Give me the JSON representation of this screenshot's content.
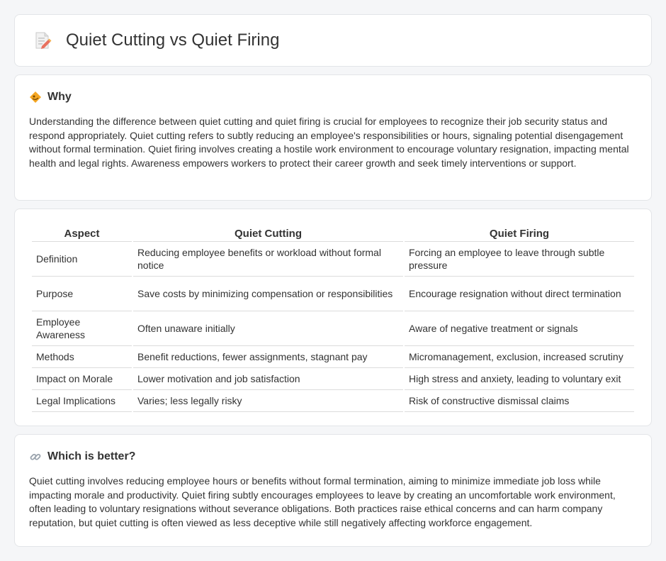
{
  "header": {
    "title": "Quiet Cutting vs Quiet Firing",
    "icon": "document-pencil-icon"
  },
  "why": {
    "title": "Why",
    "icon": "diamond-sign-icon",
    "text": "Understanding the difference between quiet cutting and quiet firing is crucial for employees to recognize their job security status and respond appropriately. Quiet cutting refers to subtly reducing an employee's responsibilities or hours, signaling potential disengagement without formal termination. Quiet firing involves creating a hostile work environment to encourage voluntary resignation, impacting mental health and legal rights. Awareness empowers workers to protect their career growth and seek timely interventions or support."
  },
  "table": {
    "headers": [
      "Aspect",
      "Quiet Cutting",
      "Quiet Firing"
    ],
    "rows": [
      [
        "Definition",
        "Reducing employee benefits or workload without formal notice",
        "Forcing an employee to leave through subtle pressure"
      ],
      [
        "Purpose",
        "Save costs by minimizing compensation or responsibilities",
        "Encourage resignation without direct termination"
      ],
      [
        "Employee Awareness",
        "Often unaware initially",
        "Aware of negative treatment or signals"
      ],
      [
        "Methods",
        "Benefit reductions, fewer assignments, stagnant pay",
        "Micromanagement, exclusion, increased scrutiny"
      ],
      [
        "Impact on Morale",
        "Lower motivation and job satisfaction",
        "High stress and anxiety, leading to voluntary exit"
      ],
      [
        "Legal Implications",
        "Varies; less legally risky",
        "Risk of constructive dismissal claims"
      ]
    ]
  },
  "better": {
    "title": "Which is better?",
    "icon": "link-icon",
    "text": "Quiet cutting involves reducing employee hours or benefits without formal termination, aiming to minimize immediate job loss while impacting morale and productivity. Quiet firing subtly encourages employees to leave by creating an uncomfortable work environment, often leading to voluntary resignations without severance obligations. Both practices raise ethical concerns and can harm company reputation, but quiet cutting is often viewed as less deceptive while still negatively affecting workforce engagement."
  },
  "colors": {
    "accent": "#f0a030",
    "icon_pink": "#e06070",
    "border": "#e3e5e8"
  }
}
